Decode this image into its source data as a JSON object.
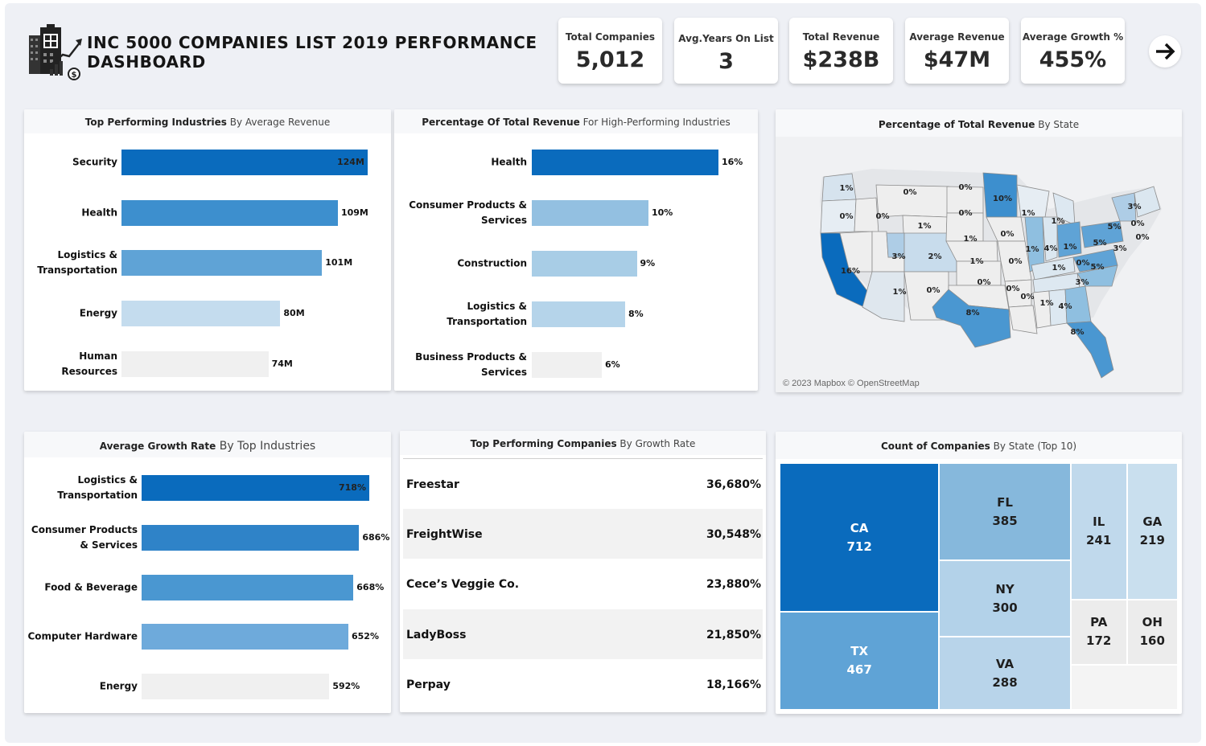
{
  "header": {
    "title": "INC 5000 COMPANIES LIST 2019 PERFORMANCE DASHBOARD",
    "logo_icon": "building-growth-icon",
    "next_icon": "arrow-right-icon"
  },
  "kpis": [
    {
      "label": "Total Companies",
      "value": "5,012"
    },
    {
      "label": "Avg.Years On List",
      "value": "3"
    },
    {
      "label": "Total Revenue",
      "value": "$238B"
    },
    {
      "label": "Average Revenue",
      "value": "$47M"
    },
    {
      "label": "Average Growth %",
      "value": "455%"
    }
  ],
  "panels": {
    "industries_revenue": {
      "title_bold": "Top Performing Industries",
      "title_rest": " By Average Revenue"
    },
    "revenue_pct": {
      "title_bold": "Percentage Of Total Revenue",
      "title_rest": " For High-Performing Industries"
    },
    "state_map": {
      "title_bold": "Percentage of Total Revenue",
      "title_rest": " By State",
      "credit": "© 2023 Mapbox © OpenStreetMap"
    },
    "growth_rate": {
      "title_bold": "Average Growth Rate",
      "title_rest": " By Top Industries"
    },
    "top_companies": {
      "title_bold": "Top Performing Companies",
      "title_rest": " By  Growth Rate"
    },
    "state_count": {
      "title_bold": "Count of Companies",
      "title_rest": " By State (Top 10)"
    }
  },
  "top_companies": [
    {
      "name": "Freestar",
      "rate": "36,680%"
    },
    {
      "name": "FreightWise",
      "rate": "30,548%"
    },
    {
      "name": "Cece’s Veggie Co.",
      "rate": "23,880%"
    },
    {
      "name": "LadyBoss",
      "rate": "21,850%"
    },
    {
      "name": "Perpay",
      "rate": "18,166%"
    }
  ],
  "map_labels": [
    "1%",
    "0%",
    "0%",
    "10%",
    "1%",
    "0%",
    "0%",
    "0%",
    "1%",
    "1%",
    "0%",
    "1%",
    "0%",
    "3%",
    "2%",
    "1%",
    "1%",
    "4%",
    "1%",
    "5%",
    "5%",
    "3%",
    "0%",
    "0%",
    "16%",
    "1%",
    "0%",
    "0%",
    "0%",
    "1%",
    "3%",
    "5%",
    "3%",
    "0%",
    "8%",
    "1%",
    "4%",
    "0%",
    "8%"
  ],
  "colors": {
    "dark": "#0a6bbd",
    "mid": "#3d8fce",
    "light": "#8fbfe0",
    "pale": "#c0d9ec",
    "grey": "#f0f0f0"
  },
  "chart_data": [
    {
      "type": "bar",
      "title": "Top Performing Industries By Average Revenue",
      "categories": [
        "Security",
        "Health",
        "Logistics & Transportation",
        "Energy",
        "Human Resources"
      ],
      "values": [
        124,
        109,
        101,
        80,
        74
      ],
      "value_labels": [
        "124M",
        "109M",
        "101M",
        "80M",
        "74M"
      ],
      "xlim": [
        0,
        124
      ],
      "colors": [
        "#0a6bbd",
        "#3d8fce",
        "#5fa3d6",
        "#c4dcee",
        "#f0f0f0"
      ]
    },
    {
      "type": "bar",
      "title": "Percentage Of Total Revenue For High-Performing Industries",
      "categories": [
        "Health",
        "Consumer Products & Services",
        "Construction",
        "Logistics & Transportation",
        "Business Products & Services"
      ],
      "values": [
        16,
        10,
        9,
        8,
        6
      ],
      "value_labels": [
        "16%",
        "10%",
        "9%",
        "8%",
        "6%"
      ],
      "xlim": [
        0,
        16
      ],
      "colors": [
        "#0a6bbd",
        "#93c0e1",
        "#a8cde6",
        "#b5d4ea",
        "#f0f0f0"
      ]
    },
    {
      "type": "bar",
      "title": "Average Growth Rate By Top Industries",
      "categories": [
        "Logistics & Transportation",
        "Consumer Products & Services",
        "Food & Beverage",
        "Computer Hardware",
        "Energy"
      ],
      "values": [
        718,
        686,
        668,
        652,
        592
      ],
      "value_labels": [
        "718%",
        "686%",
        "668%",
        "652%",
        "592%"
      ],
      "xlim": [
        0,
        718
      ],
      "colors": [
        "#0a6bbd",
        "#2f83c8",
        "#4a97d1",
        "#6eaadb",
        "#f0f0f0"
      ]
    },
    {
      "type": "heatmap",
      "title": "Count of Companies By State (Top 10)",
      "categories": [
        "CA",
        "TX",
        "FL",
        "NY",
        "VA",
        "IL",
        "GA",
        "PA",
        "OH"
      ],
      "values": [
        712,
        467,
        385,
        300,
        288,
        241,
        219,
        172,
        160
      ]
    }
  ]
}
